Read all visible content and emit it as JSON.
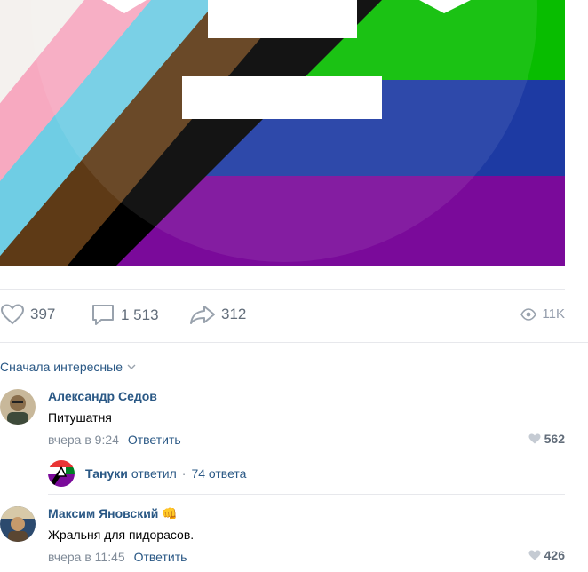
{
  "post": {
    "image_icon": "progress-pride-flag-image"
  },
  "actions": {
    "likes": "397",
    "comments": "1 513",
    "shares": "312",
    "views": "11K"
  },
  "comments_sort": {
    "label": "Сначала интересные"
  },
  "comments": [
    {
      "author": "Александр Седов",
      "text": "Питушатня",
      "time": "вчера в 9:24",
      "reply_label": "Ответить",
      "likes": "562",
      "thread": {
        "author": "Тануки",
        "verb": "ответил",
        "count": "74 ответа"
      }
    },
    {
      "author": "Максим Яновский",
      "badge": "👊",
      "text": "Жральня для пидорасов.",
      "time": "вчера в 11:45",
      "reply_label": "Ответить",
      "likes": "426"
    }
  ],
  "colors": {
    "link": "#2a5885",
    "muted": "#818c99",
    "divider": "#e7e8ec"
  }
}
